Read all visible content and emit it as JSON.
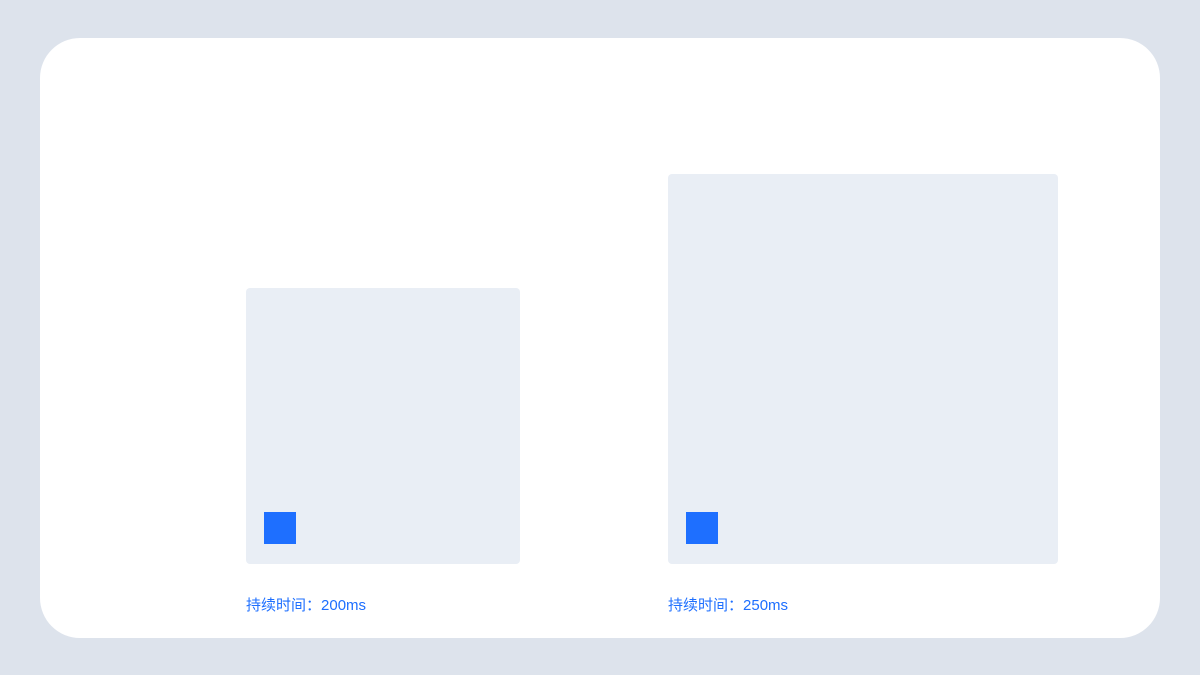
{
  "demos": {
    "left": {
      "label_prefix": "持续时间：",
      "label_value": "200ms"
    },
    "right": {
      "label_prefix": "持续时间：",
      "label_value": "250ms"
    }
  },
  "colors": {
    "page_bg": "#dde3ec",
    "card_bg": "#ffffff",
    "panel_bg": "#e9eef5",
    "accent": "#1e6fff"
  }
}
